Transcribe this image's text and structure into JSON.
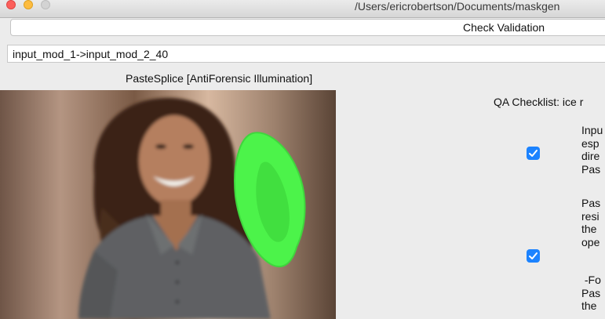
{
  "window": {
    "title": "/Users/ericrobertson/Documents/maskgen"
  },
  "toolbar": {
    "check_validation_label": "Check Validation"
  },
  "link": {
    "path_value": "input_mod_1->input_mod_2_40"
  },
  "preview": {
    "operation_label": "PasteSplice [AntiForensic Illumination]"
  },
  "qa": {
    "title": "QA Checklist: ice r",
    "items": [
      {
        "checked": true,
        "text": "Inpu\nesp\ndire\nPas"
      },
      {
        "checked": true,
        "text": "Pas\nresi\nthe\nope"
      },
      {
        "checked": false,
        "text": " -Fo\nPas\nthe"
      }
    ]
  },
  "colors": {
    "checkbox_blue": "#1c83ff",
    "mask_green": "#4cf34a"
  }
}
